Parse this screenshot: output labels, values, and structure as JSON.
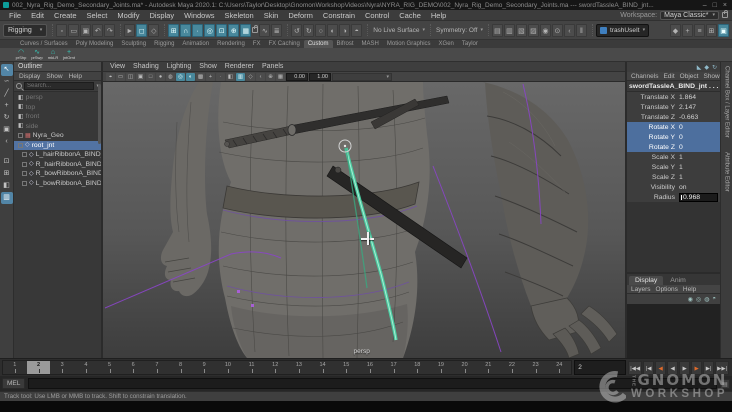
{
  "title_bar": {
    "title": "002_Nyra_Rig_Demo_Secondary_Joints.ma* - Autodesk Maya 2020.1: C:\\Users\\Taylor\\Desktop\\GnomonWorkshopVideos\\Nyra\\NYRA_RIG_DEMO\\002_Nyra_Rig_Demo_Secondary_Joints.ma  ---  swordTassleA_BIND_jnt...",
    "minimize": "–",
    "maximize": "□",
    "close": "×"
  },
  "menu_bar": {
    "items": [
      "File",
      "Edit",
      "Create",
      "Select",
      "Modify",
      "Display",
      "Windows",
      "Skeleton",
      "Skin",
      "Deform",
      "Constrain",
      "Control",
      "Cache",
      "Help"
    ],
    "workspace_label": "Workspace:",
    "workspace_value": "Maya Classic*"
  },
  "status_line": {
    "menu_set": "Rigging",
    "file_icons": [
      {
        "g": "▫",
        "n": "new-scene-icon"
      },
      {
        "g": "▭",
        "n": "open-scene-icon"
      },
      {
        "g": "▣",
        "n": "save-scene-icon"
      },
      {
        "g": "↶",
        "n": "undo-icon"
      },
      {
        "g": "↷",
        "n": "redo-icon"
      }
    ],
    "select_icons": [
      {
        "g": "►",
        "n": "select-hierarchy-icon"
      },
      {
        "g": "◻",
        "n": "select-object-icon",
        "classes": "on"
      },
      {
        "g": "◇",
        "n": "select-component-icon"
      }
    ],
    "snap_icons": [
      {
        "g": "⊞",
        "n": "snap-to-grid-icon",
        "classes": "on"
      },
      {
        "g": "∩",
        "n": "snap-to-curve-icon",
        "classes": "on"
      },
      {
        "g": "∙",
        "n": "snap-to-point-icon",
        "classes": "on"
      },
      {
        "g": "◎",
        "n": "snap-to-projected-center-icon",
        "classes": "on"
      },
      {
        "g": "⊡",
        "n": "snap-to-view-plane-icon",
        "classes": "on"
      },
      {
        "g": "⊕",
        "n": "make-live-icon",
        "classes": "on"
      },
      {
        "g": "▦",
        "n": "snap-to-mesh-icon",
        "classes": "on"
      }
    ],
    "history_icons": [
      {
        "g": "∿",
        "n": "construction-history-icon"
      },
      {
        "g": "≣",
        "n": "list-input-operations-icon"
      }
    ],
    "symmetry_icons": [
      {
        "g": "↺",
        "n": "undo-view-icon"
      },
      {
        "g": "↻",
        "n": "redo-view-icon"
      },
      {
        "g": "○",
        "n": "symmetry-object-icon"
      },
      {
        "g": "◐",
        "n": "symmetry-x-icon"
      },
      {
        "g": "◑",
        "n": "symmetry-y-icon"
      },
      {
        "g": "◓",
        "n": "symmetry-z-icon"
      }
    ],
    "no_live_surface": "No Live Surface",
    "symmetry": "Symmetry: Off",
    "render_icons": [
      {
        "g": "▤",
        "n": "render-current-frame-icon"
      },
      {
        "g": "▥",
        "n": "ipr-render-icon"
      },
      {
        "g": "▧",
        "n": "render-settings-icon"
      },
      {
        "g": "▨",
        "n": "hypershade-icon"
      },
      {
        "g": "◉",
        "n": "render-view-icon"
      },
      {
        "g": "⊙",
        "n": "launch-arnold-icon"
      },
      {
        "g": "‹",
        "n": "paint-effects-icon"
      },
      {
        "g": "‖",
        "n": "pause-viewport-icon"
      }
    ],
    "field_text": "trashUseIt",
    "right_icons": [
      {
        "g": "◆",
        "n": "modeling-toolkit-icon"
      },
      {
        "g": "+",
        "n": "humanik-icon"
      },
      {
        "g": "≡",
        "n": "attribute-editor-toggle-icon"
      },
      {
        "g": "⊞",
        "n": "tool-settings-toggle-icon"
      },
      {
        "g": "▣",
        "n": "channel-box-toggle-icon",
        "classes": "on"
      }
    ]
  },
  "shelf": {
    "tabs": [
      {
        "label": "Curves / Surfaces"
      },
      {
        "label": "Poly Modeling"
      },
      {
        "label": "Sculpting"
      },
      {
        "label": "Rigging"
      },
      {
        "label": "Animation"
      },
      {
        "label": "Rendering"
      },
      {
        "label": "FX"
      },
      {
        "label": "FX Caching"
      },
      {
        "label": "Custom",
        "classes": "active"
      },
      {
        "label": "Bifrost"
      },
      {
        "label": "MASH"
      },
      {
        "label": "Motion Graphics"
      },
      {
        "label": "XGen"
      },
      {
        "label": "Taylor"
      }
    ],
    "buttons": [
      {
        "g": "◠",
        "label": "prShp"
      },
      {
        "g": "∿",
        "label": "prSwp"
      },
      {
        "g": "⌂",
        "label": "mkLR"
      },
      {
        "g": "+",
        "label": "jntOrnt"
      }
    ]
  },
  "toolbox": {
    "tools": [
      {
        "g": "↖",
        "n": "select-tool-icon",
        "classes": "on"
      },
      {
        "g": "∽",
        "n": "lasso-tool-icon"
      },
      {
        "g": "╱",
        "n": "paint-select-tool-icon"
      },
      {
        "g": "+",
        "n": "move-tool-icon"
      },
      {
        "g": "↻",
        "n": "rotate-tool-icon"
      },
      {
        "g": "▣",
        "n": "scale-tool-icon"
      },
      {
        "g": "‹",
        "n": "last-tool-icon"
      }
    ],
    "layouts": [
      {
        "g": "⊡",
        "n": "layout-single-pane-button"
      },
      {
        "g": "⊞",
        "n": "layout-four-pane-button"
      },
      {
        "g": "◧",
        "n": "layout-two-pane-button"
      },
      {
        "g": "▥",
        "n": "layout-persp-outliner-button",
        "classes": "on"
      }
    ]
  },
  "outliner": {
    "title": "Outliner",
    "menus": [
      "Display",
      "Show",
      "Help"
    ],
    "search_placeholder": "Search...",
    "items": [
      {
        "label": "persp",
        "classes": "dim cam"
      },
      {
        "label": "top",
        "classes": "dim cam"
      },
      {
        "label": "front",
        "classes": "dim cam"
      },
      {
        "label": "side",
        "classes": "dim cam"
      },
      {
        "label": "Nyra_Geo",
        "classes": "geo box"
      },
      {
        "label": "root_jnt",
        "classes": "sel joint box"
      },
      {
        "label": "L_hairRibbonA_BIND_jnt",
        "classes": "joint box ind"
      },
      {
        "label": "R_hairRibbonA_BIND_jnt",
        "classes": "joint box ind"
      },
      {
        "label": "R_bowRibbonA_BIND_jnt",
        "classes": "joint box ind"
      },
      {
        "label": "L_bowRibbonA_BIND_jnt",
        "classes": "joint box ind"
      }
    ]
  },
  "viewport": {
    "menus": [
      "View",
      "Shading",
      "Lighting",
      "Show",
      "Renderer",
      "Panels"
    ],
    "toolbar_icons": [
      {
        "g": "⌖",
        "n": "center-view-icon"
      },
      {
        "g": "▭",
        "n": "resolution-gate-icon"
      },
      {
        "g": "◫",
        "n": "film-gate-icon"
      },
      {
        "g": "▣",
        "n": "camera-attributes-icon"
      },
      {
        "g": "□",
        "n": "wireframe-icon"
      },
      {
        "g": "●",
        "n": "shaded-icon"
      },
      {
        "g": "◍",
        "n": "textured-icon"
      },
      {
        "g": "◎",
        "n": "use-all-lights-icon",
        "classes": "on"
      },
      {
        "g": "◐",
        "n": "shadows-icon",
        "classes": "on"
      },
      {
        "g": "▩",
        "n": "ambient-occlusion-icon"
      },
      {
        "g": "+",
        "n": "motion-blur-icon"
      },
      {
        "g": "∙",
        "n": "anti-aliasing-icon"
      },
      {
        "g": "◧",
        "n": "isolate-select-icon"
      },
      {
        "g": "▥",
        "n": "xray-icon",
        "classes": "on"
      },
      {
        "g": "◇",
        "n": "xray-joints-icon"
      },
      {
        "g": "‹",
        "n": "plugin-shapes-icon"
      },
      {
        "g": "⊕",
        "n": "grease-pencil-icon"
      },
      {
        "g": "▦",
        "n": "grid-display-icon"
      }
    ],
    "fields": [
      "0.00",
      "1.00"
    ],
    "camera_label": "persp"
  },
  "channel_box": {
    "icons": [
      {
        "g": "◣",
        "n": "manip-slow-icon"
      },
      {
        "g": "◆",
        "n": "manip-medium-icon"
      },
      {
        "g": "↻",
        "n": "manip-fast-icon"
      }
    ],
    "menus": [
      "Channels",
      "Edit",
      "Object",
      "Show"
    ],
    "object_name": "swordTassleA_BIND_jnt . . .",
    "channels": [
      {
        "name": "Translate X",
        "value": "1.864"
      },
      {
        "name": "Translate Y",
        "value": "2.147"
      },
      {
        "name": "Translate Z",
        "value": "-0.663"
      },
      {
        "name": "Rotate X",
        "value": "0",
        "classes": "sel"
      },
      {
        "name": "Rotate Y",
        "value": "0",
        "classes": "sel"
      },
      {
        "name": "Rotate Z",
        "value": "0",
        "classes": "sel"
      },
      {
        "name": "Scale X",
        "value": "1"
      },
      {
        "name": "Scale Y",
        "value": "1"
      },
      {
        "name": "Scale Z",
        "value": "1"
      },
      {
        "name": "Visibility",
        "value": "on"
      },
      {
        "name": "Radius",
        "value": "0.968",
        "classes": "input"
      }
    ],
    "vertical_tabs": [
      "Channel Box / Layer Editor",
      "Attribute Editor"
    ]
  },
  "layer_editor": {
    "tabs": [
      {
        "label": "Display",
        "classes": "active"
      },
      {
        "label": "Anim"
      }
    ],
    "menus": [
      "Layers",
      "Options",
      "Help"
    ],
    "icons": [
      {
        "g": "◉",
        "n": "move-layer-icon"
      },
      {
        "g": "◎",
        "n": "empty-layer-icon"
      },
      {
        "g": "◍",
        "n": "new-layer-from-selected-icon"
      },
      {
        "g": "◓",
        "n": "new-layer-icon"
      }
    ]
  },
  "time_slider": {
    "ticks": [
      {
        "t": "1"
      },
      {
        "t": "2",
        "classes": "cur"
      },
      {
        "t": "3"
      },
      {
        "t": "4"
      },
      {
        "t": "5"
      },
      {
        "t": "6"
      },
      {
        "t": "7"
      },
      {
        "t": "8"
      },
      {
        "t": "9"
      },
      {
        "t": "10"
      },
      {
        "t": "11"
      },
      {
        "t": "12"
      },
      {
        "t": "13"
      },
      {
        "t": "14"
      },
      {
        "t": "15"
      },
      {
        "t": "16"
      },
      {
        "t": "17"
      },
      {
        "t": "18"
      },
      {
        "t": "19"
      },
      {
        "t": "20"
      },
      {
        "t": "21"
      },
      {
        "t": "22"
      },
      {
        "t": "23"
      },
      {
        "t": "24"
      }
    ],
    "current_time_field": "2",
    "playback": [
      {
        "g": "|◀◀",
        "n": "go-to-start-button"
      },
      {
        "g": "|◀",
        "n": "step-back-frame-button"
      },
      {
        "g": "◀",
        "n": "step-back-key-button",
        "classes": "key"
      },
      {
        "g": "◀",
        "n": "play-backwards-button"
      },
      {
        "g": "▶",
        "n": "play-forwards-button"
      },
      {
        "g": "▶",
        "n": "step-forward-key-button",
        "classes": "key"
      },
      {
        "g": "▶|",
        "n": "step-forward-frame-button"
      },
      {
        "g": "▶▶|",
        "n": "go-to-end-button"
      }
    ]
  },
  "command_line": {
    "label": "MEL"
  },
  "help_line": {
    "text": "Track tool: Use LMB or MMB to track. Shift to constrain translation."
  },
  "watermark": {
    "the": "THE",
    "line1": "GNOMON",
    "line2": "WORKSHOP"
  }
}
